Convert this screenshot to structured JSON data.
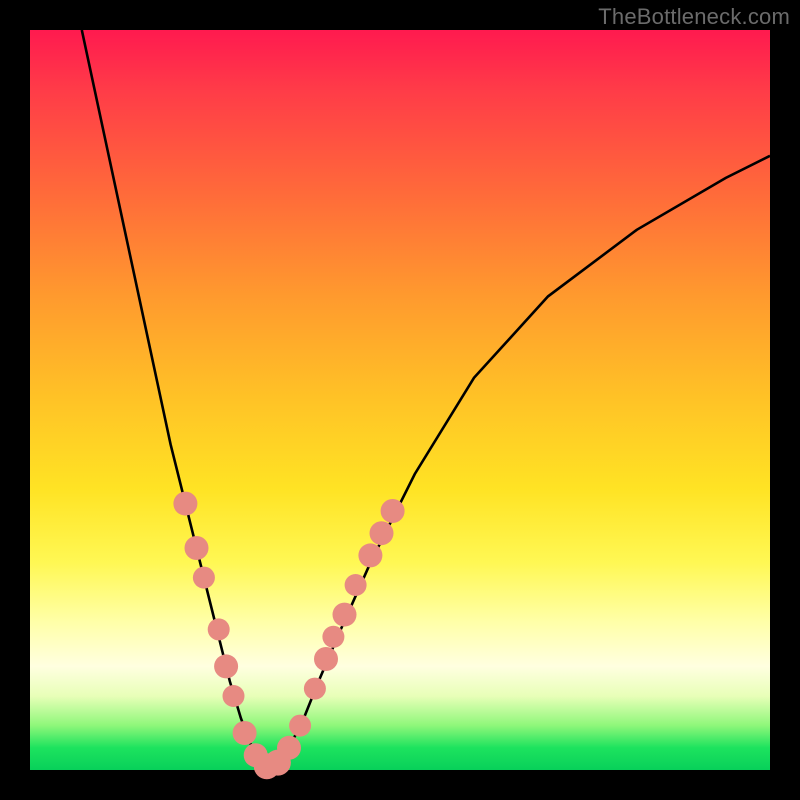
{
  "watermark": {
    "text": "TheBottleneck.com"
  },
  "chart_data": {
    "type": "line",
    "title": "",
    "xlabel": "",
    "ylabel": "",
    "xlim": [
      0,
      100
    ],
    "ylim": [
      0,
      100
    ],
    "series": [
      {
        "name": "bottleneck-curve",
        "x": [
          7,
          10,
          13,
          16,
          19,
          22,
          25,
          27,
          28.5,
          30,
          31,
          32,
          33,
          35,
          37,
          39,
          42,
          46,
          52,
          60,
          70,
          82,
          94,
          100
        ],
        "y": [
          100,
          86,
          72,
          58,
          44,
          32,
          20,
          12,
          7,
          3,
          1,
          0,
          1,
          3,
          7,
          12,
          19,
          28,
          40,
          53,
          64,
          73,
          80,
          83
        ]
      }
    ],
    "markers": [
      {
        "x": 21.0,
        "y": 36,
        "r": 12
      },
      {
        "x": 22.5,
        "y": 30,
        "r": 12
      },
      {
        "x": 23.5,
        "y": 26,
        "r": 11
      },
      {
        "x": 25.5,
        "y": 19,
        "r": 11
      },
      {
        "x": 26.5,
        "y": 14,
        "r": 12
      },
      {
        "x": 27.5,
        "y": 10,
        "r": 11
      },
      {
        "x": 29.0,
        "y": 5,
        "r": 12
      },
      {
        "x": 30.5,
        "y": 2,
        "r": 12
      },
      {
        "x": 32.0,
        "y": 0.5,
        "r": 13
      },
      {
        "x": 33.5,
        "y": 1,
        "r": 13
      },
      {
        "x": 35.0,
        "y": 3,
        "r": 12
      },
      {
        "x": 36.5,
        "y": 6,
        "r": 11
      },
      {
        "x": 38.5,
        "y": 11,
        "r": 11
      },
      {
        "x": 40.0,
        "y": 15,
        "r": 12
      },
      {
        "x": 41.0,
        "y": 18,
        "r": 11
      },
      {
        "x": 42.5,
        "y": 21,
        "r": 12
      },
      {
        "x": 44.0,
        "y": 25,
        "r": 11
      },
      {
        "x": 46.0,
        "y": 29,
        "r": 12
      },
      {
        "x": 47.5,
        "y": 32,
        "r": 12
      },
      {
        "x": 49.0,
        "y": 35,
        "r": 12
      }
    ],
    "marker_color": "#e78a82",
    "curve_color": "#000000"
  }
}
